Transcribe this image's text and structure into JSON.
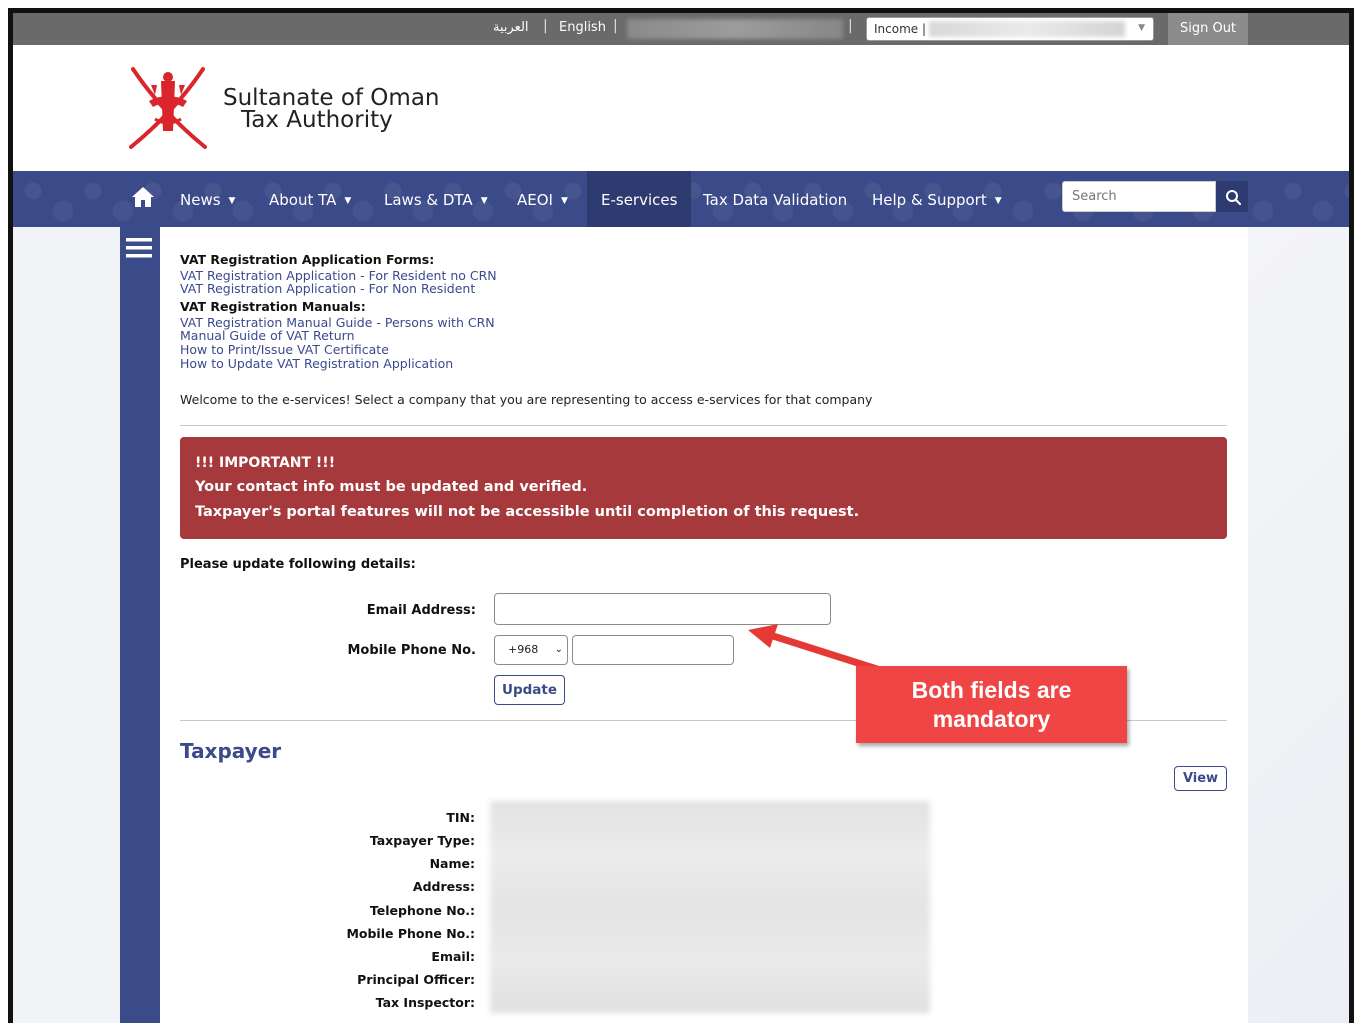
{
  "topbar": {
    "lang_arabic": "العربية",
    "lang_english": "English",
    "sep": "|",
    "select_value": "Income |",
    "select_caret": "▼",
    "sign_out": "Sign Out"
  },
  "header": {
    "org_line1": "Sultanate of Oman",
    "org_line2": "Tax Authority"
  },
  "nav": {
    "items": [
      {
        "label": "News",
        "dropdown": true
      },
      {
        "label": "About TA",
        "dropdown": true
      },
      {
        "label": "Laws & DTA",
        "dropdown": true
      },
      {
        "label": "AEOI",
        "dropdown": true
      },
      {
        "label": "E-services",
        "dropdown": false,
        "active": true
      },
      {
        "label": "Tax Data Validation",
        "dropdown": false
      },
      {
        "label": "Help & Support",
        "dropdown": true
      }
    ],
    "dropdown_glyph": "▼",
    "search_placeholder": "Search"
  },
  "content": {
    "forms_heading": "VAT Registration Application Forms:",
    "forms_links": [
      "VAT Registration Application - For Resident no CRN",
      "VAT Registration Application - For Non Resident"
    ],
    "manuals_heading": "VAT Registration Manuals:",
    "manuals_links": [
      "VAT Registration Manual Guide - Persons with CRN",
      "Manual Guide of VAT Return",
      "How to Print/Issue VAT Certificate",
      "How to Update VAT Registration Application"
    ],
    "welcome": "Welcome to the e-services! Select a company that you are representing to access e-services for that company",
    "alert": {
      "line1": "!!! IMPORTANT !!!",
      "line2": "Your contact info must be updated and verified.",
      "line3": "Taxpayer's portal features will not be accessible until completion of this request."
    },
    "update_heading": "Please update following details:",
    "email_label": "Email Address:",
    "email_value": "",
    "mobile_label": "Mobile Phone No.",
    "country_code": "+968",
    "country_code_chevron": "⌄",
    "mobile_value": "",
    "update_button": "Update",
    "taxpayer_heading": "Taxpayer",
    "view_button": "View",
    "info_labels": [
      "TIN:",
      "Taxpayer Type:",
      "Name:",
      "Address:",
      "Telephone No.:",
      "Mobile Phone No.:",
      "Email:",
      "Principal Officer:",
      "Tax Inspector:"
    ]
  },
  "callout": {
    "line1": "Both fields are",
    "line2": "mandatory",
    "color": "#f04545"
  },
  "colors": {
    "brand_blue": "#3b4a88",
    "alert_red": "#a6393b",
    "link_blue": "#3a4a8e"
  },
  "icons": {
    "home": "home-icon",
    "search": "search-icon",
    "menu": "hamburger-menu-icon",
    "emblem": "oman-emblem-logo"
  }
}
